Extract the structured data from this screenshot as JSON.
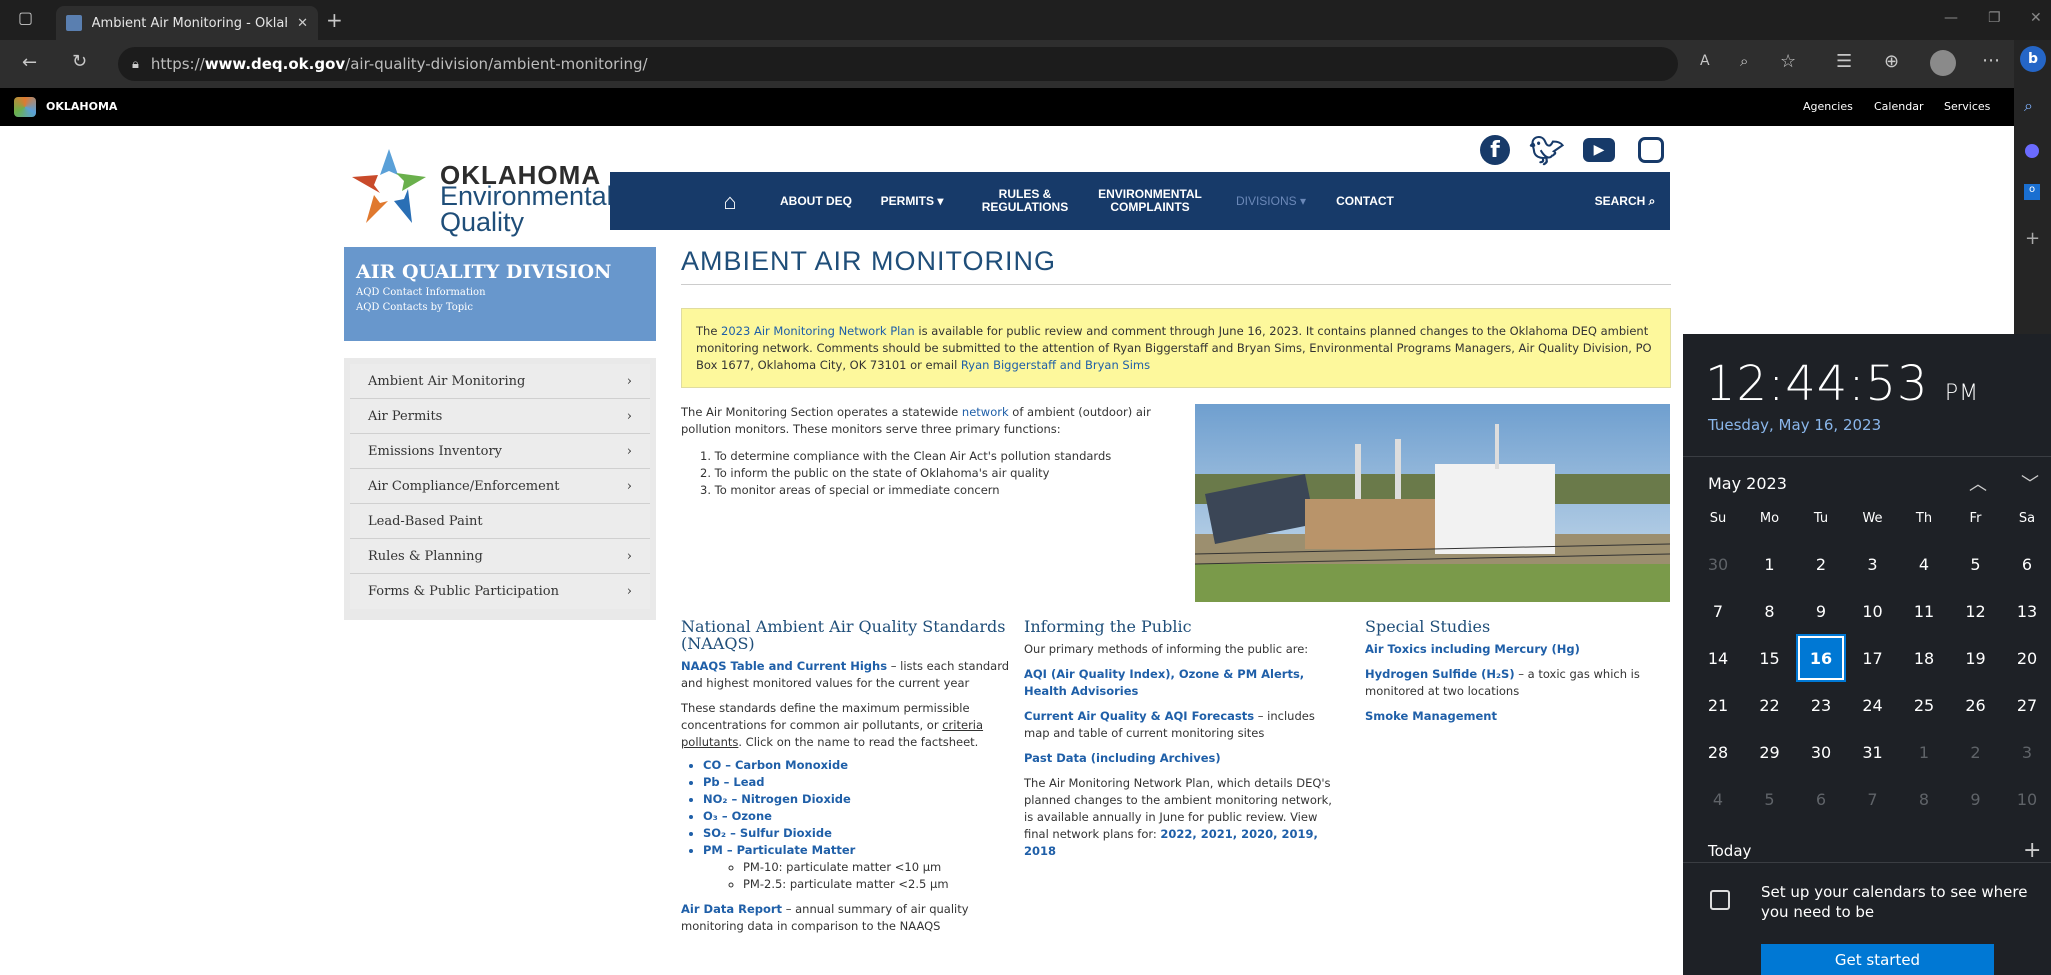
{
  "browser": {
    "tab_title": "Ambient Air Monitoring - Oklaho",
    "url_prefix": "https://",
    "url_host": "www.deq.ok.gov",
    "url_path": "/air-quality-division/ambient-monitoring/"
  },
  "state_bar": {
    "logo_label": "OKLAHOMA",
    "links": [
      "Agencies",
      "Calendar",
      "Services"
    ]
  },
  "site": {
    "logo_line1": "OKLAHOMA",
    "logo_line2": "Environmental",
    "logo_line3": "Quality",
    "nav": {
      "about": "ABOUT DEQ",
      "permits": "PERMITS",
      "rules1": "RULES &",
      "rules2": "REGULATIONS",
      "env1": "ENVIRONMENTAL",
      "env2": "COMPLAINTS",
      "divisions": "DIVISIONS",
      "contact": "CONTACT",
      "search": "SEARCH"
    }
  },
  "aqd": {
    "title": "AIR QUALITY DIVISION",
    "link1": "AQD Contact Information",
    "link2": "AQD Contacts by Topic"
  },
  "left_menu": [
    {
      "label": "Ambient Air Monitoring",
      "chevron": "›"
    },
    {
      "label": "Air Permits",
      "chevron": "›"
    },
    {
      "label": "Emissions Inventory",
      "chevron": "›"
    },
    {
      "label": "Air Compliance/Enforcement",
      "chevron": "›"
    },
    {
      "label": "Lead-Based Paint",
      "chevron": ""
    },
    {
      "label": "Rules & Planning",
      "chevron": "›"
    },
    {
      "label": "Forms & Public Participation",
      "chevron": "›"
    }
  ],
  "main": {
    "title": "AMBIENT AIR MONITORING",
    "notice_pre": "The ",
    "notice_link": "2023 Air Monitoring Network Plan",
    "notice_text": " is available for public review and comment through June 16, 2023. It contains planned changes to the Oklahoma DEQ ambient monitoring network. Comments should be submitted to the attention of Ryan Biggerstaff and Bryan Sims, Environmental Programs Managers, Air Quality Division, PO Box 1677, Oklahoma City, OK 73101 or email ",
    "notice_email": "Ryan Biggerstaff and Bryan Sims",
    "intro_pre": "The Air Monitoring Section operates a statewide ",
    "intro_link": "network",
    "intro_post": " of ambient (outdoor) air pollution monitors. These monitors serve three primary functions:",
    "functions": [
      "1. To determine compliance with the Clean Air Act's pollution standards",
      "2. To inform the public on the state of Oklahoma's air quality",
      "3. To monitor areas of special or immediate concern"
    ],
    "naaqs": {
      "heading1": "National Ambient Air Quality Standards",
      "heading2": "(NAAQS)",
      "table_link": "NAAQS Table and Current Highs",
      "table_desc": " – lists each standard and highest monitored values for the current year",
      "para_pre": "These standards define the maximum permissible concentrations for common air pollutants, or ",
      "para_link": "criteria pollutants",
      "para_post": ". Click on the name to read the factsheet.",
      "pollutants": [
        "CO – Carbon Monoxide",
        "Pb – Lead",
        "NO₂ – Nitrogen Dioxide",
        "O₃ – Ozone",
        "SO₂ – Sulfur Dioxide",
        "PM – Particulate Matter"
      ],
      "pm10": "PM-10: particulate matter <10 µm",
      "pm25": "PM-2.5: particulate matter <2.5 µm",
      "report_link": "Air Data Report",
      "report_desc": " – annual summary of air quality monitoring data in comparison to the NAAQS"
    },
    "informing": {
      "heading": "Informing the Public",
      "intro": "Our primary methods of informing the public are:",
      "aqi_link": "AQI (Air Quality Index), Ozone & PM Alerts, Health Advisories",
      "forecast_link": "Current Air Quality & AQI Forecasts",
      "forecast_desc": " – includes map and table of current monitoring sites",
      "past_link": "Past Data (including Archives)",
      "plan_text": "The Air Monitoring Network Plan, which details DEQ's planned changes to the ambient monitoring network, is available annually in June for public review. View final network plans for: ",
      "plan_years": "2022, 2021, 2020, 2019, 2018"
    },
    "special": {
      "heading": "Special Studies",
      "toxics_link": "Air Toxics including Mercury (Hg)",
      "h2s_link": "Hydrogen Sulfide (H₂S)",
      "h2s_desc": " – a toxic gas which is monitored at two locations",
      "smoke_link": "Smoke Management"
    }
  },
  "clock": {
    "time": "12:44:53",
    "ampm": "PM",
    "date": "Tuesday, May 16, 2023",
    "month": "May 2023",
    "weekdays": [
      "Su",
      "Mo",
      "Tu",
      "We",
      "Th",
      "Fr",
      "Sa"
    ],
    "weeks": [
      [
        "30",
        "1",
        "2",
        "3",
        "4",
        "5",
        "6"
      ],
      [
        "7",
        "8",
        "9",
        "10",
        "11",
        "12",
        "13"
      ],
      [
        "14",
        "15",
        "16",
        "17",
        "18",
        "19",
        "20"
      ],
      [
        "21",
        "22",
        "23",
        "24",
        "25",
        "26",
        "27"
      ],
      [
        "28",
        "29",
        "30",
        "31",
        "1",
        "2",
        "3"
      ],
      [
        "4",
        "5",
        "6",
        "7",
        "8",
        "9",
        "10"
      ]
    ],
    "selected_day": "16",
    "today_label": "Today",
    "setup_text1": "Set up your calendars to see where",
    "setup_text2": "you need to be",
    "get_started": "Get started"
  },
  "colors": {
    "nav_blue": "#173a69",
    "accent_blue": "#1f5fa8",
    "notice_yellow": "#fdf89c",
    "cal_selected": "#0078d4"
  }
}
